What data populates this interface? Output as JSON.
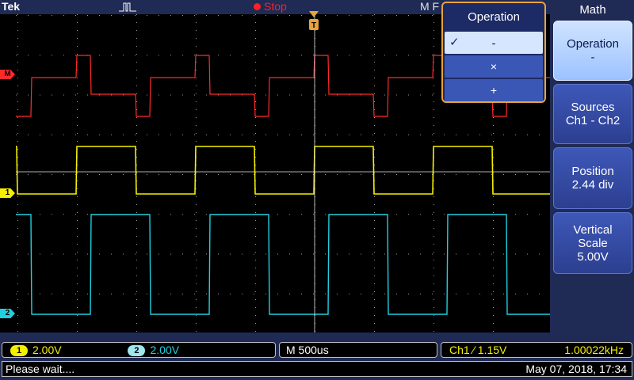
{
  "brand": "Tek",
  "run_state": "Stop",
  "horizontal_mode": "M F",
  "channel_markers": {
    "math": "M",
    "ch1": "1",
    "ch2": "2"
  },
  "colors": {
    "math": "#ff2a2a",
    "ch1": "#f4f000",
    "ch2": "#20d0e0",
    "trigger": "#e8a33c",
    "grid": "#9a9a9a"
  },
  "side_menu": {
    "title": "Math",
    "buttons": [
      {
        "label": "Operation",
        "value": "-"
      },
      {
        "label": "Sources",
        "value": "Ch1 - Ch2"
      },
      {
        "label": "Position",
        "value": "2.44 div"
      },
      {
        "label": "Vertical Scale",
        "value": "5.00V"
      }
    ]
  },
  "popup": {
    "title": "Operation",
    "options": [
      {
        "label": "-",
        "selected": true,
        "check": "✓"
      },
      {
        "label": "×",
        "selected": false,
        "check": ""
      },
      {
        "label": "+",
        "selected": false,
        "check": ""
      }
    ]
  },
  "readouts": {
    "ch1_label": "1",
    "ch1_scale": "2.00V",
    "ch2_label": "2",
    "ch2_scale": "2.00V",
    "timebase": "M 500us",
    "trigger": "Ch1 ⁄ 1.15V",
    "frequency": "1.00022kHz"
  },
  "status": {
    "message": "Please wait....",
    "datetime": "May 07, 2018, 17:34"
  }
}
